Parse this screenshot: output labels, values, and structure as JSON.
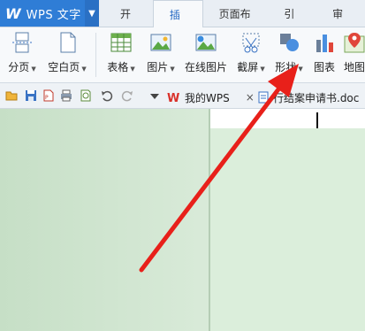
{
  "app": {
    "logo": "W",
    "title": "WPS 文字",
    "dropdown_icon": "triangle-down-icon"
  },
  "tabs": [
    {
      "label": "开始",
      "active": false
    },
    {
      "label": "插入",
      "active": true
    },
    {
      "label": "页面布局",
      "active": false
    },
    {
      "label": "引用",
      "active": false
    },
    {
      "label": "审阅",
      "active": false
    }
  ],
  "ribbon": {
    "page_break": "分页",
    "blank_page": "空白页",
    "table": "表格",
    "picture": "图片",
    "online_picture": "在线图片",
    "screenshot": "截屏",
    "shape": "形状",
    "chart": "图表",
    "map": "地图"
  },
  "quickbar": {
    "my_wps_tab": "我的WPS",
    "close_glyph": "×",
    "doc_tab": "行结案申请书.doc"
  },
  "colors": {
    "accent": "#2f7dd6",
    "arrow": "#e8201a",
    "doc_bg": "#d3e7d3"
  }
}
